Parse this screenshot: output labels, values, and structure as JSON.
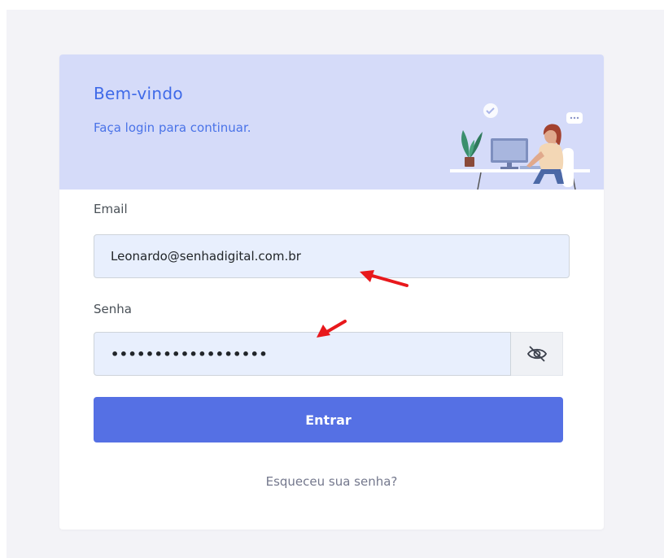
{
  "header": {
    "title": "Bem-vindo",
    "subtitle": "Faça login para continuar."
  },
  "form": {
    "email_label": "Email",
    "email_value": "Leonardo@senhadigital.com.br",
    "password_label": "Senha",
    "password_value": "••••••••••••••••••",
    "submit_label": "Entrar",
    "forgot_password": "Esqueceu sua senha?"
  },
  "icons": {
    "password_toggle": "eye-slash-icon",
    "illustration": "person-at-desk-illustration",
    "annotation": "red-arrow"
  },
  "colors": {
    "header_bg": "#d5dbf9",
    "accent": "#5570e4",
    "title": "#3f6ae8",
    "input_bg": "#e8effd",
    "annotation_arrow": "#e8181c"
  }
}
